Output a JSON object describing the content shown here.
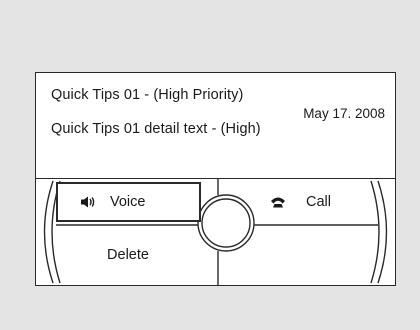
{
  "message": {
    "title": "Quick Tips 01 - (High Priority)",
    "date": "May 17. 2008",
    "detail": "Quick Tips 01 detail text - (High)"
  },
  "buttons": {
    "voice_label": "Voice",
    "call_label": "Call",
    "delete_label": "Delete"
  },
  "icons": {
    "voice": "speaker-icon",
    "call": "phone-handset-icon"
  },
  "colors": {
    "background": "#e4e4e4",
    "panel": "#ffffff",
    "stroke": "#2a2a2a"
  }
}
